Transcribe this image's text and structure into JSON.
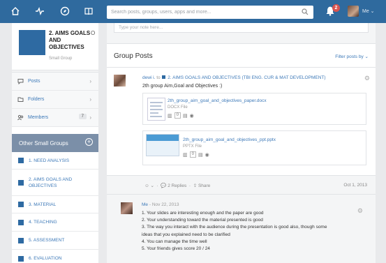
{
  "topbar": {
    "search_placeholder": "Search posts, groups, users, apps and more...",
    "notification_count": "2",
    "user_label": "Me",
    "brand_color": "#2f6a9e"
  },
  "sidebar": {
    "group_title": "2. AIMS GOALS AND OBJECTIVES",
    "group_title_mark": "O",
    "group_subtitle": "Small Group",
    "items": [
      {
        "label": "Posts",
        "icon": "speech-bubble-icon"
      },
      {
        "label": "Folders",
        "icon": "folder-icon"
      },
      {
        "label": "Members",
        "icon": "members-icon",
        "count": "7"
      }
    ],
    "other_groups_title": "Other Small Groups",
    "other_groups": [
      "1. NEED ANALYSIS",
      "2. AIMS GOALS AND OBJECTIVES",
      "3. MATERIAL",
      "4. TEACHING",
      "5. ASSESSMENT",
      "6. EVALUATION"
    ]
  },
  "main": {
    "note_placeholder": "Type your note here...",
    "posts_title": "Group Posts",
    "filter_label": "Filter posts by",
    "post": {
      "author": "dewi i.",
      "to": "to",
      "group": "2. AIMS GOALS AND OBJECTIVES (TBI ENG. CUR & MAT DEVELOPMENT)",
      "text": "2th group Aim,Goal and Objectives :)",
      "files": [
        {
          "name": "2th_group_aim_goal_and_objectives_paper.docx",
          "type": "DOCX File",
          "count": "0"
        },
        {
          "name": "2th_group_aim_goal_and_objectives_ppt.pptx",
          "type": "PPTX File",
          "count": "0"
        }
      ],
      "replies": "2 Replies",
      "share": "Share",
      "date": "Oct 1, 2013"
    },
    "comment": {
      "author": "Me",
      "date": "Nov 22, 2013",
      "lines": [
        "1. Your slides are interesting enough and the paper are good",
        "2. Your understanding toward the material presented is good",
        "3. The way you interact with the audience during the presentation is good also, though some",
        "ideas that you explained need to be clarified",
        "4. You can manage the time well",
        "5. Your friends gives score 20 / 24"
      ]
    }
  }
}
